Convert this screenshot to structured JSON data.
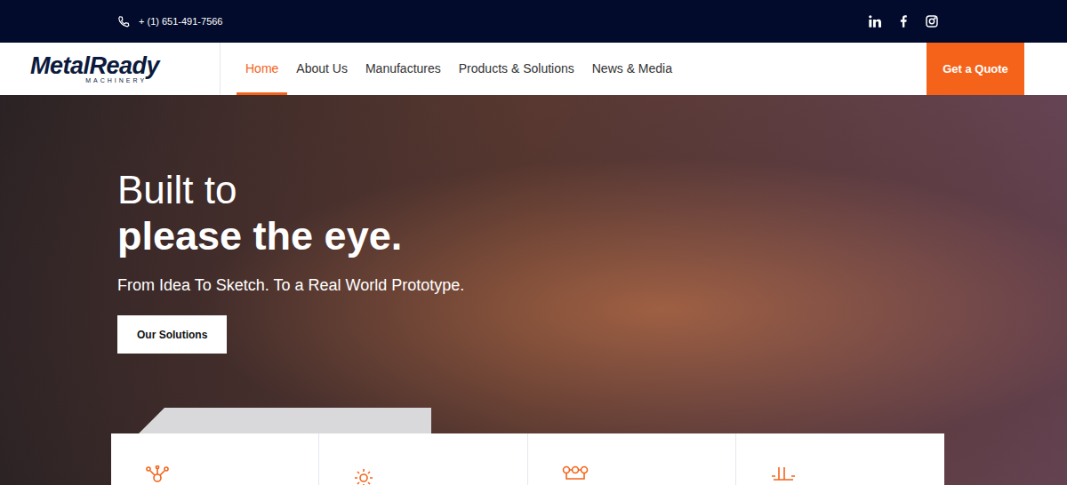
{
  "topbar": {
    "phone": "+ (1) 651-491-7566"
  },
  "logo": {
    "name": "MetalReady",
    "tagline": "MACHINERY"
  },
  "nav": {
    "items": [
      {
        "label": "Home",
        "selected": true
      },
      {
        "label": "About Us",
        "selected": false
      },
      {
        "label": "Manufactures",
        "selected": false
      },
      {
        "label": "Products & Solutions",
        "selected": false
      },
      {
        "label": "News & Media",
        "selected": false
      }
    ],
    "cta": "Get a Quote"
  },
  "hero": {
    "title_line1": "Built to",
    "title_line2": "please the eye.",
    "subtitle": "From Idea To Sketch. To a Real World Prototype.",
    "button": "Our Solutions"
  }
}
